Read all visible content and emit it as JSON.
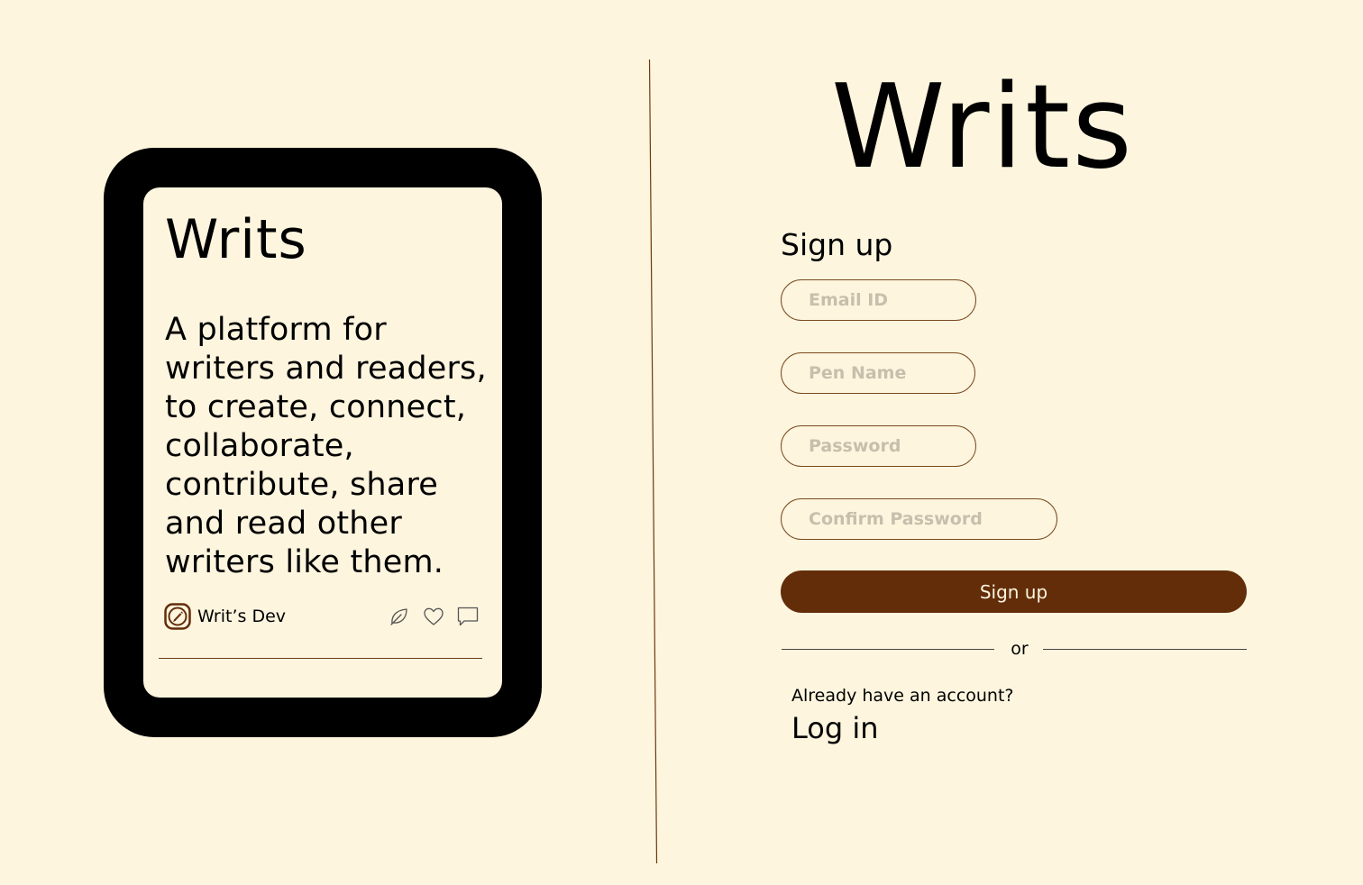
{
  "preview_card": {
    "title": "Writs",
    "description": "A platform for writers and readers, to create, connect, collaborate, contribute, share and read other writers like them.",
    "author": {
      "name": "Writ’s Dev",
      "icon": "pencil-icon"
    },
    "actions": [
      {
        "icon": "leaf-icon"
      },
      {
        "icon": "heart-icon"
      },
      {
        "icon": "comment-icon"
      }
    ]
  },
  "brand": {
    "title": "Writs"
  },
  "signup_form": {
    "heading": "Sign up",
    "fields": {
      "email": {
        "placeholder": "Email ID",
        "value": ""
      },
      "pen_name": {
        "placeholder": "Pen Name",
        "value": ""
      },
      "password": {
        "placeholder": "Password",
        "value": ""
      },
      "confirm_password": {
        "placeholder": "Confirm Password",
        "value": ""
      }
    },
    "submit_label": "Sign up",
    "separator": "or",
    "account_prompt": "Already have an account?",
    "login_label": "Log in"
  },
  "colors": {
    "background": "#fdf5de",
    "accent_brown": "#632d0a",
    "field_border": "#7a4a20",
    "device_frame": "#000000"
  }
}
